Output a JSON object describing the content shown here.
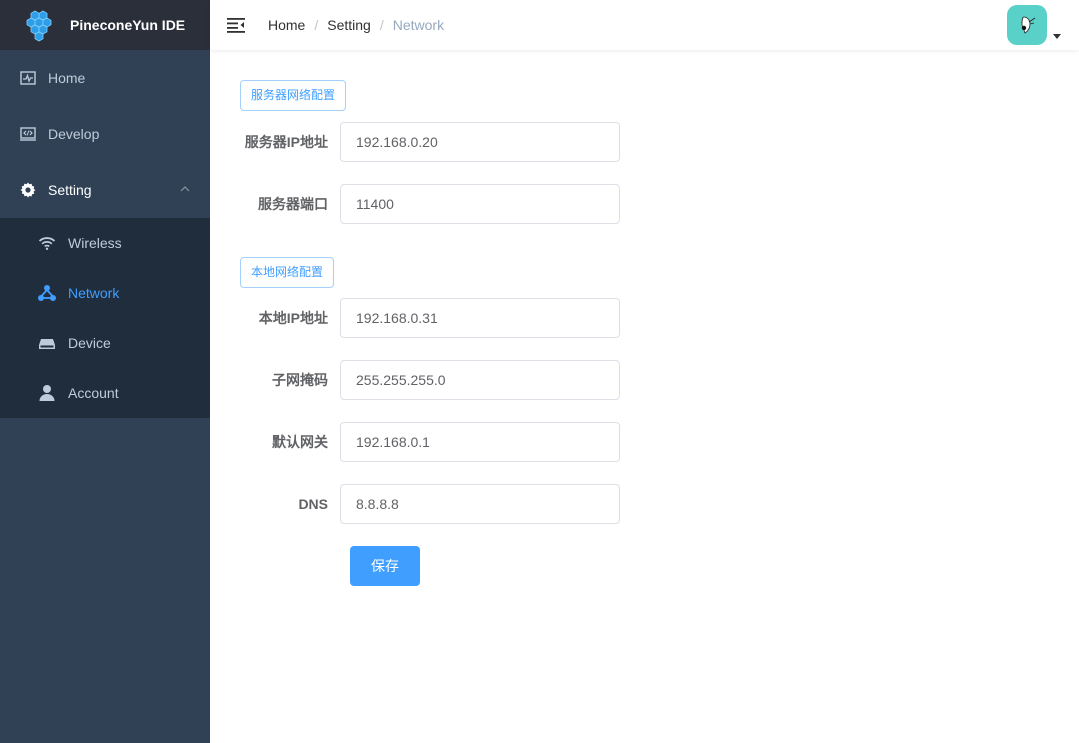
{
  "app": {
    "title": "PineconeYun IDE"
  },
  "sidebar": {
    "items": [
      {
        "label": "Home",
        "icon": "dashboard-icon"
      },
      {
        "label": "Develop",
        "icon": "code-icon"
      },
      {
        "label": "Setting",
        "icon": "gear-icon",
        "expanded": true
      }
    ],
    "subitems": [
      {
        "label": "Wireless",
        "icon": "wifi-icon"
      },
      {
        "label": "Network",
        "icon": "network-icon",
        "active": true
      },
      {
        "label": "Device",
        "icon": "device-icon"
      },
      {
        "label": "Account",
        "icon": "user-icon"
      }
    ]
  },
  "header": {
    "breadcrumb": [
      "Home",
      "Setting",
      "Network"
    ],
    "separator": "/"
  },
  "form": {
    "server_section": "服务器网络配置",
    "server_ip_label": "服务器IP地址",
    "server_ip_value": "192.168.0.20",
    "server_port_label": "服务器端口",
    "server_port_value": "11400",
    "local_section": "本地网络配置",
    "local_ip_label": "本地IP地址",
    "local_ip_value": "192.168.0.31",
    "subnet_label": "子网掩码",
    "subnet_value": "255.255.255.0",
    "gateway_label": "默认网关",
    "gateway_value": "192.168.0.1",
    "dns_label": "DNS",
    "dns_value": "8.8.8.8",
    "save_label": "保存"
  },
  "colors": {
    "sidebar_bg": "#304156",
    "submenu_bg": "#1f2d3d",
    "accent": "#409eff",
    "avatar_bg": "#5ad1c8"
  }
}
